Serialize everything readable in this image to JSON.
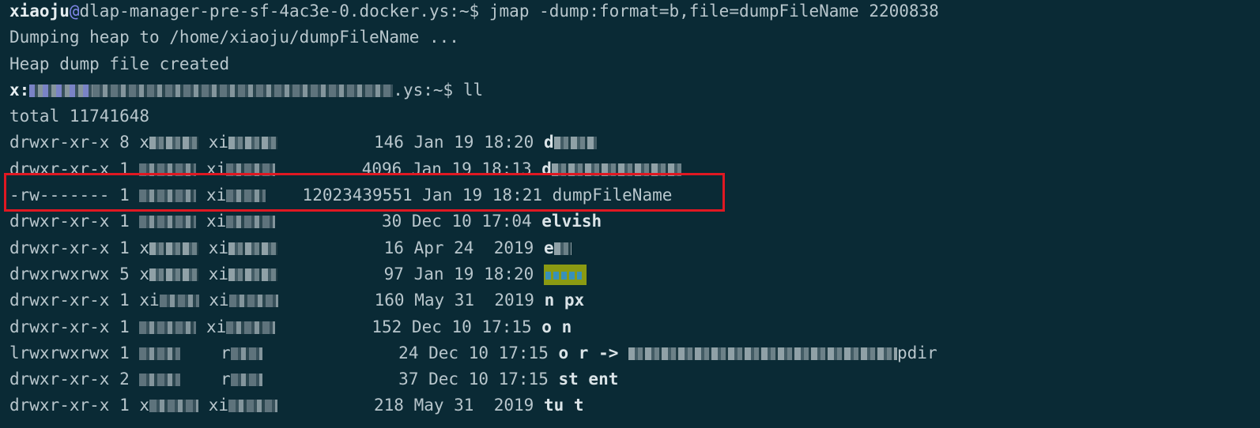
{
  "terminal": {
    "prompt1_user": "xiaoju",
    "prompt1_at": "@",
    "prompt1_host": "dlap-manager-pre-sf-4ac3e-0.docker.ys:~$ ",
    "command1": "jmap -dump:format=b,file=dumpFileName 2200838",
    "output1": "Dumping heap to /home/xiaoju/dumpFileName ...",
    "output2": "Heap dump file created",
    "prompt2_user_partial": "x:",
    "prompt2_host_suffix": ".ys:~$ ",
    "command2": "ll",
    "total": "total 11741648",
    "rows": [
      {
        "perms": "drwxr-xr-x 8 ",
        "owner": "x",
        "group": "xi",
        "size": "146",
        "date": "Jan 19 18:20",
        "name": "d"
      },
      {
        "perms": "drwxr-xr-x 1 ",
        "owner": "",
        "group": "xi",
        "size": "4096",
        "date": "Jan 19 18:13",
        "name": "d"
      },
      {
        "perms": "-rw------- 1 ",
        "owner": "",
        "group": "xi",
        "size": "12023439551",
        "date": "Jan 19 18:21",
        "name": "dumpFileName"
      },
      {
        "perms": "drwxr-xr-x 1 ",
        "owner": "",
        "group": "xi",
        "size": "30",
        "date": "Dec 10 17:04",
        "name": "elvish"
      },
      {
        "perms": "drwxr-xr-x 1 ",
        "owner": "x",
        "group": "xi",
        "size": "16",
        "date": "Apr 24  2019",
        "name": "e"
      },
      {
        "perms": "drwxrwxrwx 5 ",
        "owner": "x",
        "group": "xi",
        "size": "97",
        "date": "Jan 19 18:20",
        "name": ""
      },
      {
        "perms": "drwxr-xr-x 1 ",
        "owner": "xi",
        "group": "xi",
        "size": "160",
        "date": "May 31  2019",
        "name": "n px"
      },
      {
        "perms": "drwxr-xr-x 1 ",
        "owner": "",
        "group": "xi",
        "size": "152",
        "date": "Dec 10 17:15",
        "name": "o n"
      },
      {
        "perms": "lrwxrwxrwx 1 ",
        "owner": "",
        "group": "r",
        "size": "24",
        "date": "Dec 10 17:15",
        "name": "o r -> ",
        "link_suffix": "pdir"
      },
      {
        "perms": "drwxr-xr-x 2 ",
        "owner": "",
        "group": "r",
        "size": "37",
        "date": "Dec 10 17:15",
        "name": "st ent"
      },
      {
        "perms": "drwxr-xr-x 1 ",
        "owner": "x",
        "group": "xi",
        "size": "218",
        "date": "May 31  2019",
        "name": "tu t"
      }
    ]
  },
  "colors": {
    "background": "#0a2a35",
    "text": "#b8c6cc",
    "highlight_border": "#e01822",
    "at_sign": "#7f86e6",
    "dir_bg": "#8b9a12"
  }
}
